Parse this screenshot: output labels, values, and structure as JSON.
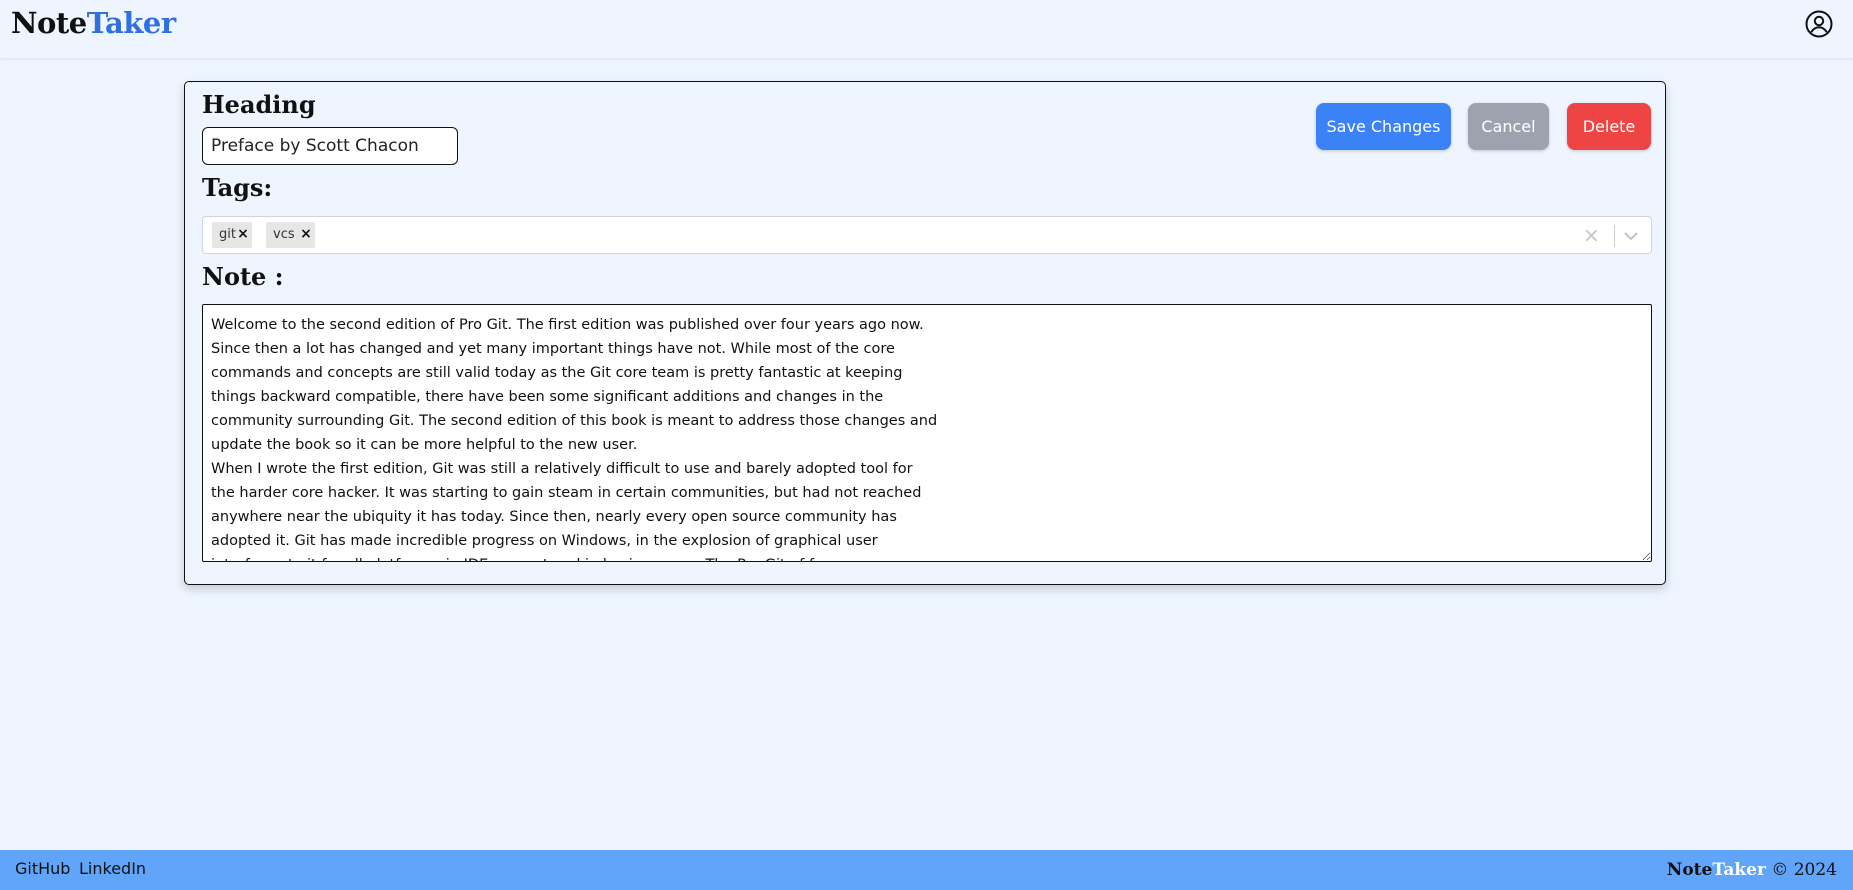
{
  "header": {
    "brand_part1": "Note",
    "brand_part2": "Taker",
    "user_icon": "user-circle-icon"
  },
  "editor": {
    "heading_label": "Heading",
    "heading_value": "Preface by Scott Chacon",
    "tags_label": "Tags:",
    "tags": [
      "git",
      "vcs"
    ],
    "note_label": "Note :",
    "note_value": "Welcome to the second edition of Pro Git. The first edition was published over four years ago now.\nSince then a lot has changed and yet many important things have not. While most of the core\ncommands and concepts are still valid today as the Git core team is pretty fantastic at keeping\nthings backward compatible, there have been some significant additions and changes in the\ncommunity surrounding Git. The second edition of this book is meant to address those changes and\nupdate the book so it can be more helpful to the new user.\nWhen I wrote the first edition, Git was still a relatively difficult to use and barely adopted tool for\nthe harder core hacker. It was starting to gain steam in certain communities, but had not reached\nanywhere near the ubiquity it has today. Since then, nearly every open source community has\nadopted it. Git has made incredible progress on Windows, in the explosion of graphical user\ninterfaces to it for all platforms, in IDE support and in business use. The Pro Git of four"
  },
  "actions": {
    "save_label": "Save Changes",
    "cancel_label": "Cancel",
    "delete_label": "Delete"
  },
  "footer": {
    "links": [
      "GitHub",
      "LinkedIn"
    ],
    "brand_part1": "Note",
    "brand_part2": "Taker",
    "copyright": "© 2024"
  },
  "colors": {
    "background": "#eef5fe",
    "brand_accent": "#2f6fe0",
    "save": "#3b82f6",
    "cancel": "#9ca3af",
    "delete": "#ef4444",
    "footer": "#60a5fa"
  }
}
